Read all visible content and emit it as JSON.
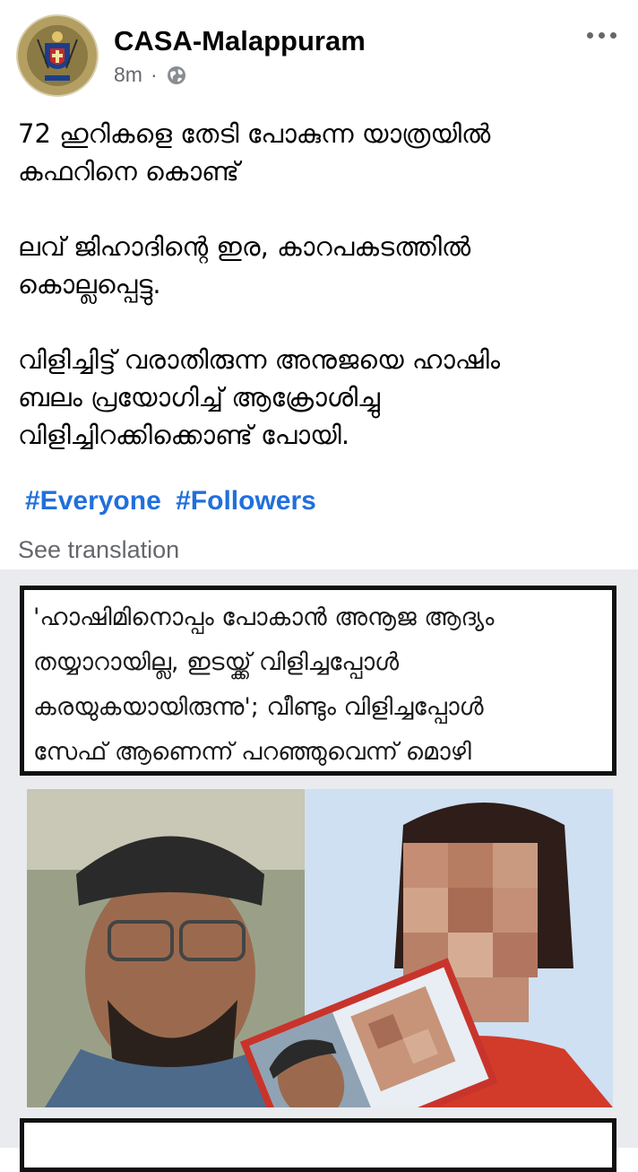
{
  "post": {
    "author": "CASA-Malappuram",
    "time": "8m",
    "separator": "·",
    "privacy_icon": "globe-icon",
    "menu_icon": "more-dots-icon",
    "paragraphs": [
      "72 ഹുറികളെ തേടി പോകുന്ന യാത്രയിൽ\nകഫറിനെ കൊണ്ട്",
      "ലവ് ജിഹാദിന്റെ ഇര, കാറപകടത്തിൽ\nകൊല്ലപ്പെട്ടു.",
      "വിളിച്ചിട്ട് വരാതിരുന്ന അനുജയെ ഹാഷിം\nബലം പ്രയോഗിച്ച് ആക്രോശിച്ചു\nവിളിച്ചിറക്കിക്കൊണ്ട് പോയി."
    ],
    "hashtags": [
      "#Everyone",
      "#Followers"
    ],
    "see_translation": "See translation"
  },
  "media": {
    "headline_lines": [
      "'ഹാഷിമിനൊപ്പം പോകാൻ അനൂജ ആദ്യം",
      "തയ്യാറായില്ല, ഇടയ്ക്ക് വിളിച്ചപ്പോൾ",
      "കരയുകയായിരുന്നു'; വീണ്ടും വിളിച്ചപ്പോൾ",
      "സേഫ് ആണെന്ന് പറഞ്ഞുവെന്ന് മൊഴി"
    ]
  },
  "colors": {
    "link_blue": "#216fdb",
    "meta_gray": "#65676b",
    "media_bg": "#e9ebee"
  }
}
